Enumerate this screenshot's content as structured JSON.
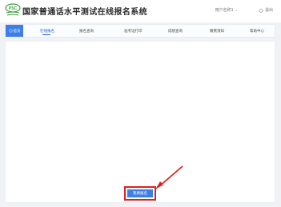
{
  "header": {
    "title": "国家普通话水平测试在线报名系统",
    "logo_text": "PSC",
    "user_label": "用户名称1",
    "logout_label": "退出"
  },
  "nav": {
    "home_label": "首页",
    "items": [
      {
        "label": "在线报名"
      },
      {
        "label": "报名查询"
      },
      {
        "label": "准考证打印"
      },
      {
        "label": "成绩查询"
      },
      {
        "label": "缴费须知"
      },
      {
        "label": "帮助中心"
      }
    ]
  },
  "main": {
    "register_button_label": "我要报名"
  },
  "colors": {
    "accent": "#3d7fe6",
    "annotation": "#e02020",
    "logo_green": "#3a9b3c"
  },
  "icons": [
    "psc-logo-icon",
    "home-icon",
    "chevron-down-icon",
    "power-icon",
    "arrow-annotation-icon"
  ]
}
